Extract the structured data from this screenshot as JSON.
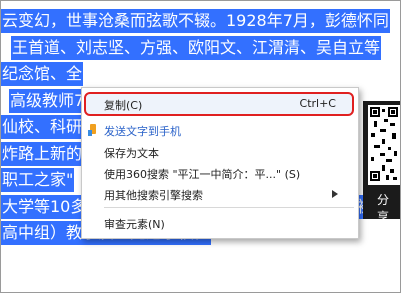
{
  "page_lines": [
    "云变幻，世事沧桑而弦歌不辍。1928年7月，彭德怀同",
    "王首道、刘志坚、方强、欧阳文、江渭清、吴自立等",
    "纪念馆、全",
    "高级教师7",
    "仙校、科研",
    "炸路上新的",
    "职工之家\"",
    "大学等10多所高校授予\"优秀生源基地学校\"称号；被",
    "高中组）教学质量先进学校。"
  ],
  "sidebar": {
    "share_label": "分享"
  },
  "context_menu": {
    "items": [
      {
        "label": "复制(C)",
        "shortcut": "Ctrl+C"
      },
      {
        "label": "发送文字到手机"
      },
      {
        "label": "保存为文本"
      },
      {
        "label": "使用360搜索 \"平江一中简介：平...\" (S)"
      },
      {
        "label": "用其他搜索引擎搜索"
      },
      {
        "label": "审查元素(N)"
      }
    ],
    "icons": {
      "send_to_phone": "phone-icon",
      "other_search": "chevron-right-icon"
    }
  },
  "colors": {
    "selection": "#3370ff",
    "highlight_border": "#e02020",
    "send_link": "#2a62c9"
  }
}
